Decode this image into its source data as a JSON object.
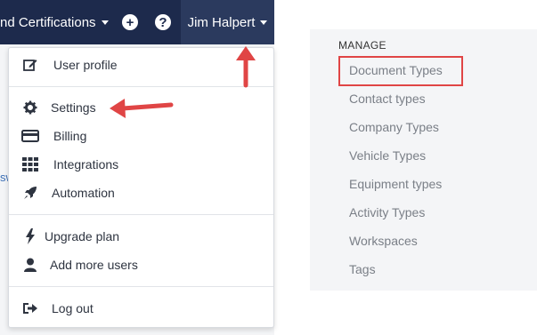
{
  "topbar": {
    "title": "nd Certifications",
    "add_icon": "plus-icon",
    "help_icon": "question-icon",
    "user_name": "Jim Halpert"
  },
  "left_edge_text": "sw",
  "dropdown": {
    "items": [
      {
        "label": "User profile",
        "icon": "edit-icon"
      },
      {
        "label": "Settings",
        "icon": "gear-icon"
      },
      {
        "label": "Billing",
        "icon": "credit-card-icon"
      },
      {
        "label": "Integrations",
        "icon": "grid-icon"
      },
      {
        "label": "Automation",
        "icon": "rocket-icon"
      },
      {
        "label": "Upgrade plan",
        "icon": "bolt-icon"
      },
      {
        "label": "Add more users",
        "icon": "user-icon"
      },
      {
        "label": "Log out",
        "icon": "sign-out-icon"
      }
    ]
  },
  "manage": {
    "title": "MANAGE",
    "items": [
      "Document Types",
      "Contact types",
      "Company Types",
      "Vehicle Types",
      "Equipment types",
      "Activity Types",
      "Workspaces",
      "Tags"
    ]
  },
  "colors": {
    "topbar": "#1d2a4c",
    "annotation_red": "#e04545"
  }
}
